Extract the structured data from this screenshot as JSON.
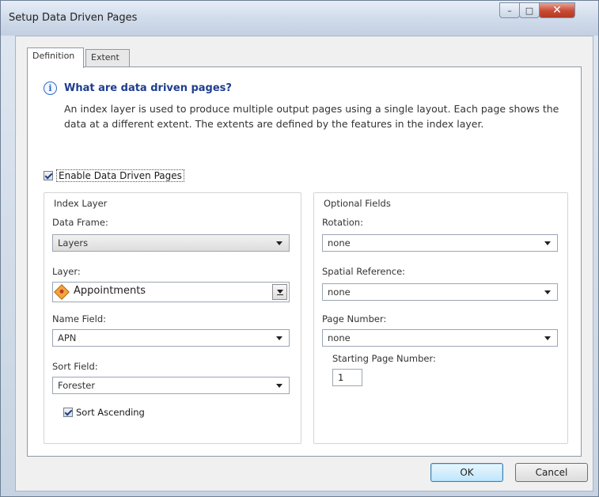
{
  "window": {
    "title": "Setup Data Driven Pages",
    "controls": [
      "minimize",
      "maximize",
      "close"
    ]
  },
  "tabs": [
    {
      "label": "Definition",
      "active": true
    },
    {
      "label": "Extent",
      "active": false
    }
  ],
  "info": {
    "icon": "info-icon",
    "heading": "What are data driven pages?",
    "text": "An index layer is used to produce multiple output pages using a single layout.  Each page shows the data at a different extent.  The extents are defined by the features in the index layer."
  },
  "enable": {
    "label": "Enable Data Driven Pages",
    "checked": true
  },
  "index_layer": {
    "title": "Index Layer",
    "data_frame": {
      "label": "Data Frame:",
      "value": "Layers"
    },
    "layer": {
      "label": "Layer:",
      "value": "Appointments",
      "icon": "polygon-layer-icon"
    },
    "name_field": {
      "label": "Name Field:",
      "value": "APN"
    },
    "sort_field": {
      "label": "Sort Field:",
      "value": "Forester"
    },
    "sort_ascending": {
      "label": "Sort Ascending",
      "checked": true
    }
  },
  "optional_fields": {
    "title": "Optional Fields",
    "rotation": {
      "label": "Rotation:",
      "value": "none"
    },
    "spatial_reference": {
      "label": "Spatial Reference:",
      "value": "none"
    },
    "page_number": {
      "label": "Page Number:",
      "value": "none"
    },
    "starting_page_number": {
      "label": "Starting Page Number:",
      "value": "1"
    }
  },
  "buttons": {
    "ok": "OK",
    "cancel": "Cancel"
  }
}
